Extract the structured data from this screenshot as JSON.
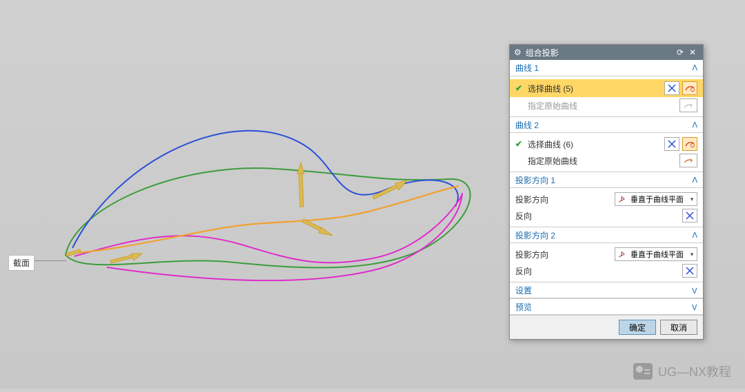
{
  "viewport": {
    "annotation_label": "截面"
  },
  "dialog": {
    "title": "组合投影",
    "sections": {
      "curve1": {
        "header": "曲线 1",
        "select_label": "选择曲线 (5)",
        "original_label": "指定原始曲线"
      },
      "curve2": {
        "header": "曲线 2",
        "select_label": "选择曲线 (6)",
        "original_label": "指定原始曲线"
      },
      "proj1": {
        "header": "投影方向 1",
        "direction_label": "投影方向",
        "direction_value": "垂直于曲线平面",
        "reverse_label": "反向"
      },
      "proj2": {
        "header": "投影方向 2",
        "direction_label": "投影方向",
        "direction_value": "垂直于曲线平面",
        "reverse_label": "反向"
      },
      "settings": {
        "header": "设置"
      },
      "preview": {
        "header": "预览"
      }
    },
    "buttons": {
      "ok": "确定",
      "cancel": "取消"
    }
  },
  "watermark": "UG—NX教程"
}
